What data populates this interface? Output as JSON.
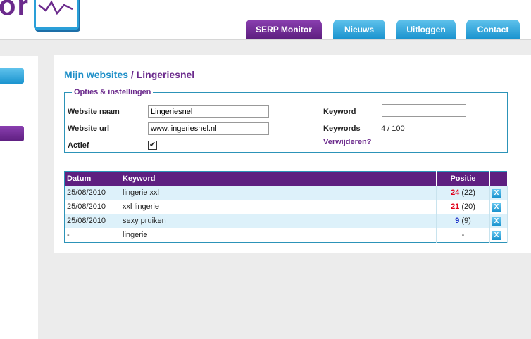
{
  "logo": {
    "text": "or"
  },
  "nav": {
    "tabs": [
      {
        "label": "SERP Monitor",
        "active": true
      },
      {
        "label": "Nieuws",
        "active": false
      },
      {
        "label": "Uitloggen",
        "active": false
      },
      {
        "label": "Contact",
        "active": false
      }
    ]
  },
  "breadcrumb": {
    "link": "Mijn websites",
    "separator": "/",
    "current": "Lingeriesnel"
  },
  "options": {
    "legend": "Opties & instellingen",
    "website_naam_label": "Website naam",
    "website_naam_value": "Lingeriesnel",
    "website_url_label": "Website url",
    "website_url_value": "www.lingeriesnel.nl",
    "actief_label": "Actief",
    "actief_checked": "✔",
    "keyword_label": "Keyword",
    "keyword_value": "",
    "keywords_label": "Keywords",
    "keywords_value": "4 / 100",
    "delete_label": "Verwijderen?"
  },
  "table": {
    "headers": {
      "datum": "Datum",
      "keyword": "Keyword",
      "positie": "Positie"
    },
    "rows": [
      {
        "datum": "25/08/2010",
        "keyword": "lingerie xxl",
        "pos": "24",
        "prev": "(22)",
        "pos_color": "#e0001a"
      },
      {
        "datum": "25/08/2010",
        "keyword": "xxl lingerie",
        "pos": "21",
        "prev": "(20)",
        "pos_color": "#e0001a"
      },
      {
        "datum": "25/08/2010",
        "keyword": "sexy pruiken",
        "pos": "9",
        "prev": "(9)",
        "pos_color": "#1a2fc8"
      },
      {
        "datum": "-",
        "keyword": "lingerie",
        "pos": "-",
        "prev": "",
        "pos_color": "#222222"
      }
    ],
    "delete_icon": "X"
  },
  "colors": {
    "purple": "#6b2a8c",
    "blue": "#1e8fc8",
    "border": "#2c93b8"
  }
}
